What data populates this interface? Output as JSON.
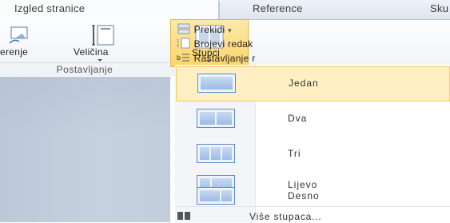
{
  "tabs": [
    {
      "label": "Izgled stranice",
      "active": true
    },
    {
      "label": "Reference",
      "active": false
    },
    {
      "label": "Sku",
      "active": false
    }
  ],
  "ribbon": {
    "buttons": [
      {
        "label": "erenje",
        "icon": "orientation-icon"
      },
      {
        "label": "Veličina",
        "icon": "page-size-icon"
      },
      {
        "label": "Stupci",
        "icon": "columns-icon"
      }
    ],
    "small_buttons": [
      {
        "label": "Prekidi",
        "icon": "breaks-icon",
        "has_dropdown": true
      },
      {
        "label": "Brojevi redak",
        "icon": "line-numbers-icon"
      },
      {
        "label": "Rastavljanje r",
        "icon": "hyphenation-icon"
      }
    ],
    "group_label": "Postavljanje"
  },
  "menu": {
    "items": [
      {
        "label": "Jedan",
        "columns": 1,
        "highlighted": true
      },
      {
        "label": "Dva",
        "columns": 2,
        "highlighted": false
      },
      {
        "label": "Tri",
        "columns": 3,
        "highlighted": false
      },
      {
        "label": "Lijevo",
        "columns": 2,
        "highlighted": false
      },
      {
        "label": "Desno",
        "columns": 2,
        "highlighted": false
      }
    ],
    "more_label": "Više stupaca..."
  },
  "colors": {
    "highlight_fill": "#ffefc2",
    "highlight_border": "#f2cc63",
    "icon_blue": "#5a8ad0"
  }
}
